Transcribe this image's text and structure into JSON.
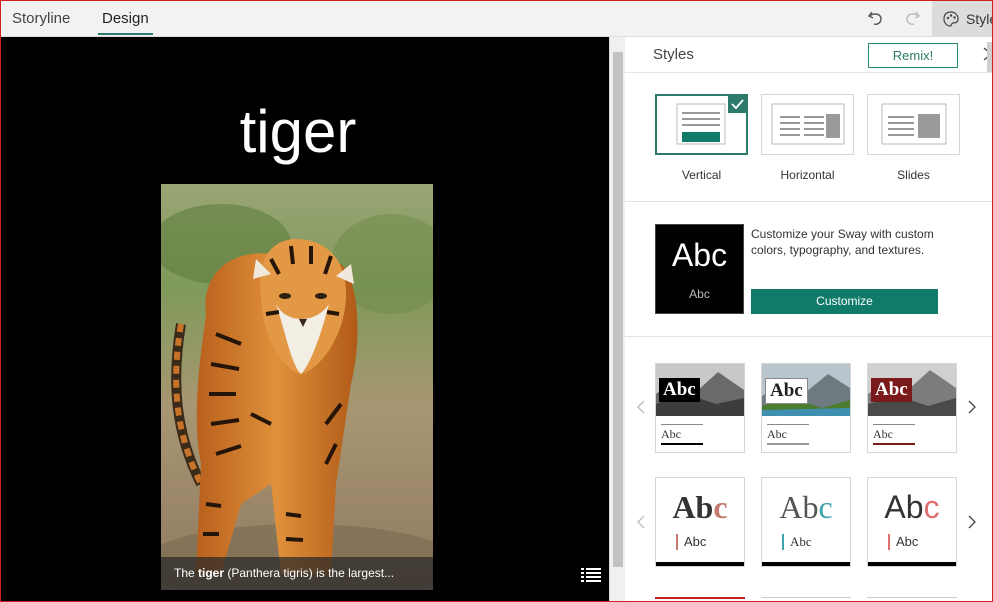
{
  "tabs": [
    {
      "label": "Storyline"
    },
    {
      "label": "Design"
    }
  ],
  "toolbar": {
    "styles_label": "Styles"
  },
  "canvas": {
    "title": "tiger",
    "caption_bold": "tiger",
    "caption_pre": "The ",
    "caption_post": " (Panthera tigris) is the largest..."
  },
  "panel": {
    "title": "Styles",
    "remix_label": "Remix!",
    "layouts": [
      {
        "label": "Vertical",
        "selected": true
      },
      {
        "label": "Horizontal",
        "selected": false
      },
      {
        "label": "Slides",
        "selected": false
      }
    ],
    "customize": {
      "preview_big": "Abc",
      "preview_small": "Abc",
      "description": "Customize your Sway with custom colors, typography, and textures.",
      "button_label": "Customize"
    },
    "themes_row1": [
      {
        "abc": "Abc",
        "sub": "Abc",
        "accent": "#000000"
      },
      {
        "abc": "Abc",
        "sub": "Abc",
        "accent": "#9a9a9a"
      },
      {
        "abc": "Abc",
        "sub": "Abc",
        "accent": "#7a1a1a"
      }
    ],
    "themes_row2": [
      {
        "abc_main": "Ab",
        "abc_last": "c",
        "sub": "Abc",
        "accent": "#c47a70"
      },
      {
        "abc_main": "Ab",
        "abc_last": "c",
        "sub": "Abc",
        "accent": "#3fa3b0"
      },
      {
        "abc_main": "Ab",
        "abc_last": "c",
        "sub": "Abc",
        "accent": "#e07070"
      }
    ]
  },
  "colors": {
    "accent": "#2c7a6b",
    "button": "#0f7b68"
  }
}
